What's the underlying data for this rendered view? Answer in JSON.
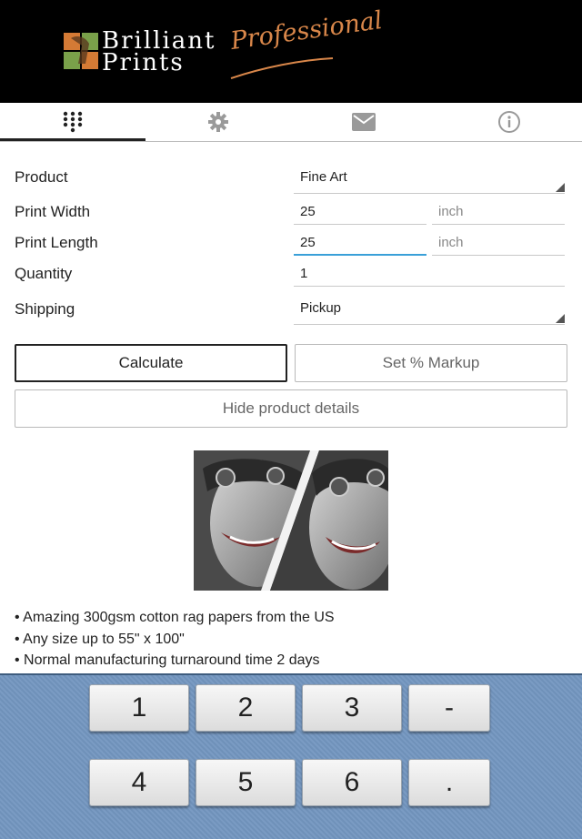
{
  "header": {
    "brand_line1": "Brilliant",
    "brand_line2": "Prints",
    "subtitle": "Professional"
  },
  "tabs": [
    {
      "icon": "keypad-icon",
      "active": true
    },
    {
      "icon": "gear-icon",
      "active": false
    },
    {
      "icon": "mail-icon",
      "active": false
    },
    {
      "icon": "info-icon",
      "active": false
    }
  ],
  "form": {
    "product_label": "Product",
    "product_value": "Fine Art",
    "width_label": "Print Width",
    "width_value": "25",
    "width_unit": "inch",
    "length_label": "Print Length",
    "length_value": "25",
    "length_unit": "inch",
    "quantity_label": "Quantity",
    "quantity_value": "1",
    "shipping_label": "Shipping",
    "shipping_value": "Pickup"
  },
  "buttons": {
    "calculate": "Calculate",
    "markup": "Set % Markup",
    "hide_details": "Hide product details"
  },
  "details": [
    "• Amazing 300gsm cotton rag papers from the US",
    "• Any size up to 55\" x 100\"",
    "• Normal manufacturing turnaround time 2 days"
  ],
  "keypad": {
    "keys": [
      "1",
      "2",
      "3",
      "-",
      "4",
      "5",
      "6",
      "."
    ]
  },
  "colors": {
    "header_bg": "#000000",
    "accent_orange": "#d9874a",
    "focus_blue": "#3aa0d8",
    "keypad_bg": "#7596be"
  }
}
